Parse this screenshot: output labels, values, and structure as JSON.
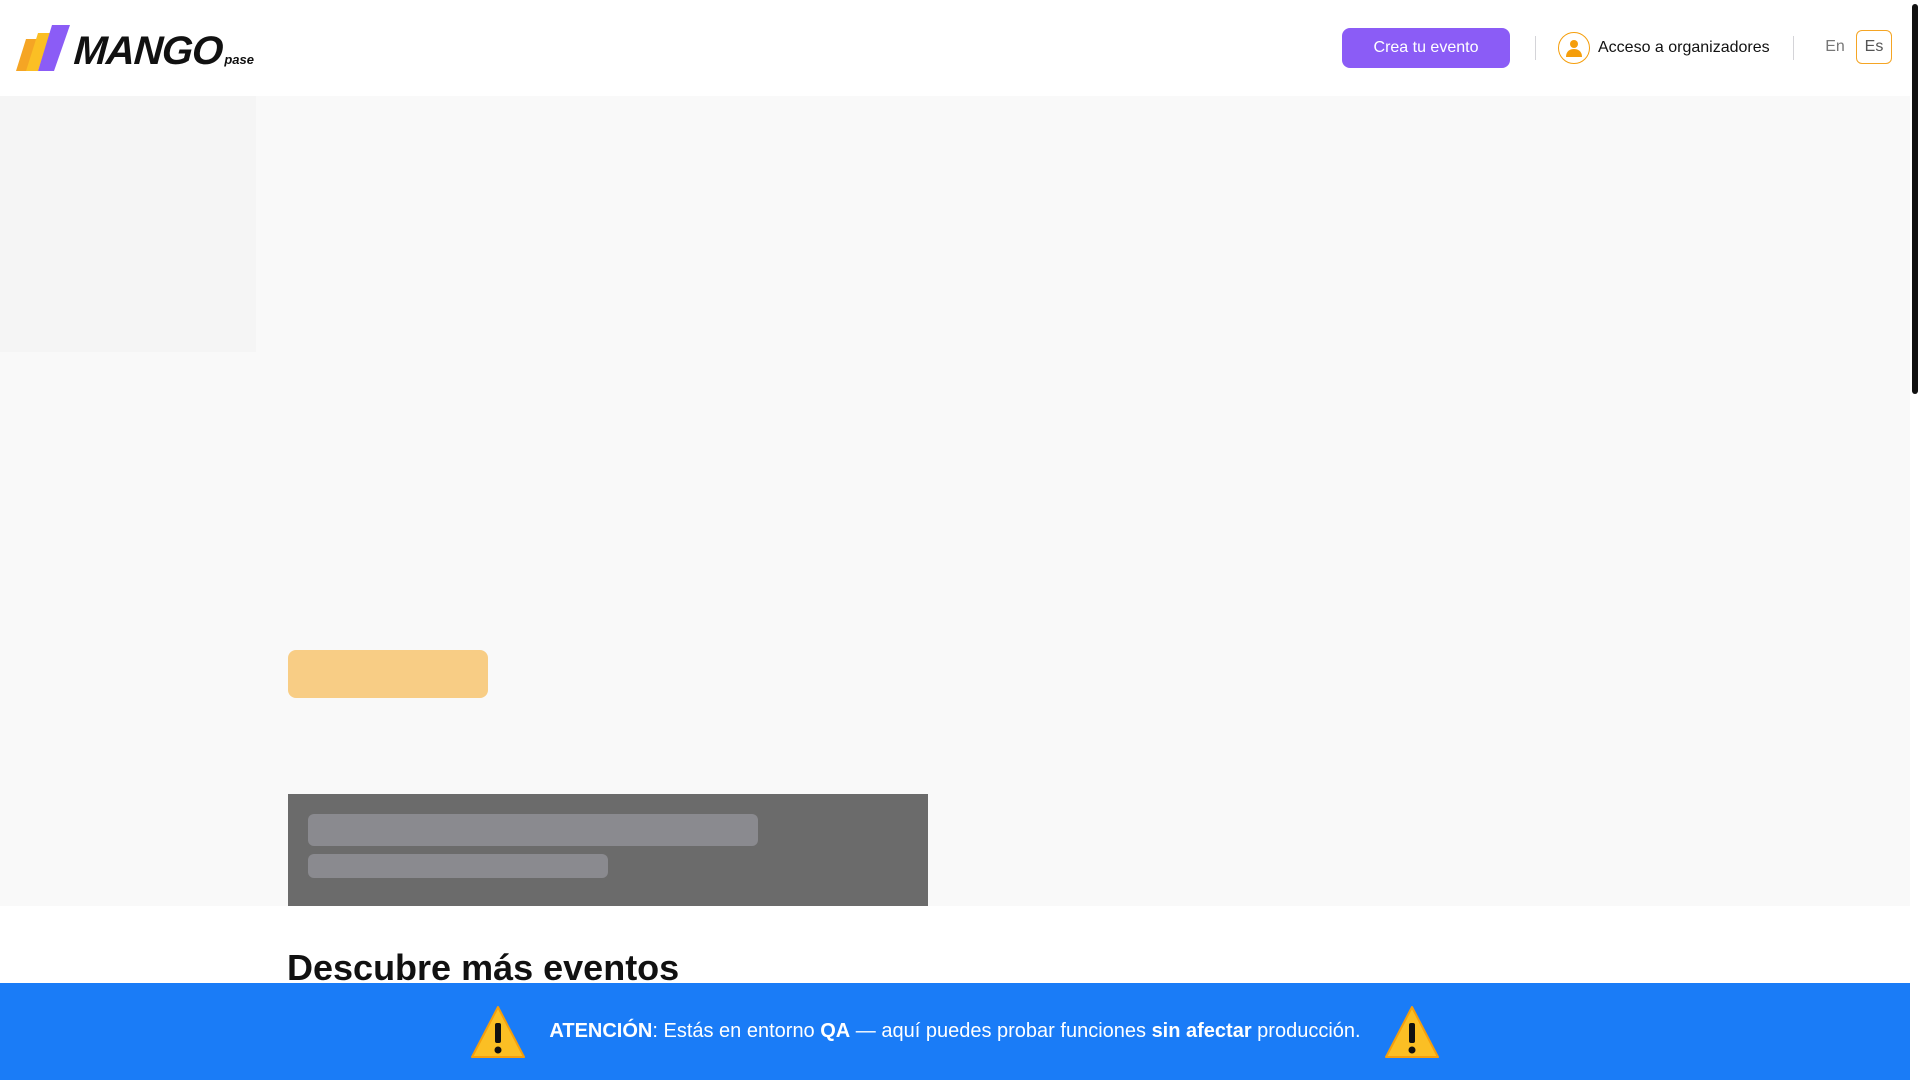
{
  "header": {
    "logo_text": "MANGO",
    "logo_sub": "pase",
    "create_button": "Crea tu evento",
    "organizer_access": "Acceso a organizadores",
    "languages": [
      "En",
      "Es"
    ],
    "selected_language": "Es"
  },
  "main": {
    "section_title_light": "Descubre ",
    "section_title_bold": "más eventos"
  },
  "banner": {
    "label": "ATENCIÓN",
    "part1": ": Estás en entorno ",
    "env": "QA",
    "part2": " — aquí puedes probar funciones ",
    "emphasis": "sin afectar",
    "part3": " producción."
  },
  "colors": {
    "primary": "#8b5cf6",
    "accent": "#f5a524",
    "banner": "#1a7cf7"
  },
  "icons": {
    "org": "user-circle-icon",
    "warning": "warning-icon"
  }
}
